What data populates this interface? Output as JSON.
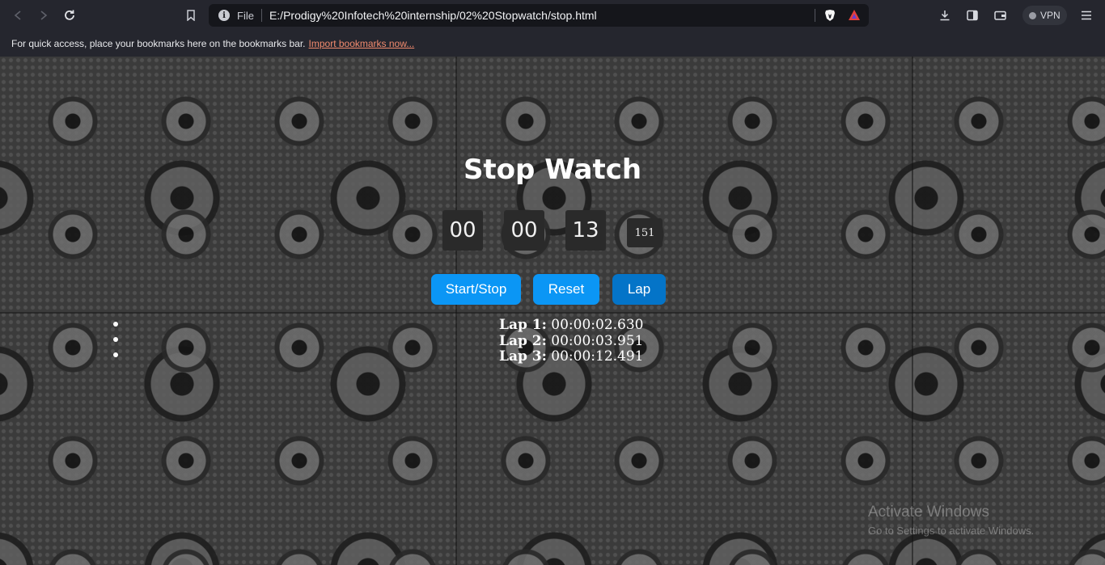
{
  "browser": {
    "scheme_label": "File",
    "url": "E:/Prodigy%20Infotech%20internship/02%20Stopwatch/stop.html",
    "vpn_label": "VPN",
    "bookmarks_message": "For quick access, place your bookmarks here on the bookmarks bar.",
    "bookmarks_link": "Import bookmarks now..."
  },
  "stopwatch": {
    "title": "Stop Watch",
    "hours": "00",
    "minutes": "00",
    "seconds": "13",
    "milliseconds": "151",
    "buttons": {
      "start_stop": "Start/Stop",
      "reset": "Reset",
      "lap": "Lap"
    },
    "laps": [
      {
        "label": "Lap 1:",
        "time": "00:00:02.630"
      },
      {
        "label": "Lap 2:",
        "time": "00:00:03.951"
      },
      {
        "label": "Lap 3:",
        "time": "00:00:12.491"
      }
    ]
  },
  "os_watermark": {
    "line1": "Activate Windows",
    "line2": "Go to Settings to activate Windows."
  },
  "colors": {
    "button_blue": "#0b96f5",
    "button_blue_dark": "#0474c8",
    "digit_box": "#2a2a2a",
    "chrome_bg": "#25262e"
  }
}
